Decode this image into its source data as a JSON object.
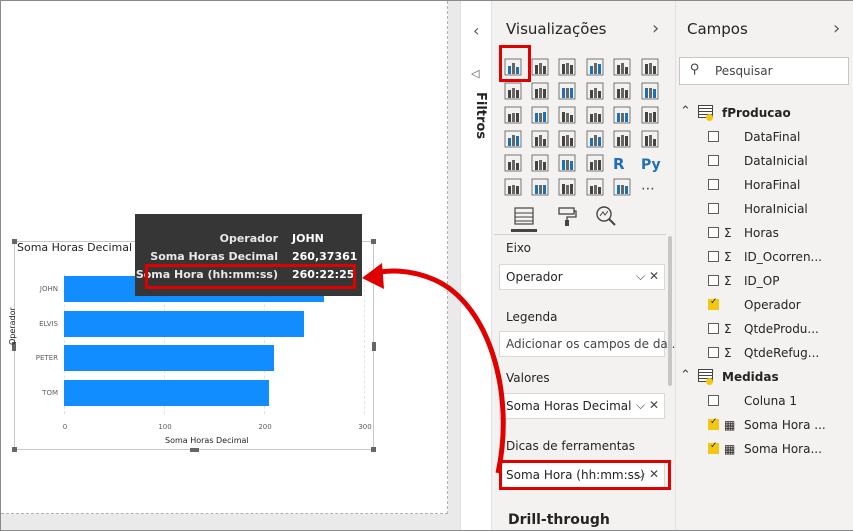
{
  "chart": {
    "title": "Soma Horas Decimal e",
    "xaxis_title": "Soma Horas Decimal",
    "yaxis_title": "Operador",
    "bar_color": "#118dff"
  },
  "chart_data": {
    "type": "bar",
    "orientation": "horizontal",
    "title": "Soma Horas Decimal e",
    "xlabel": "Soma Horas Decimal",
    "ylabel": "Operador",
    "categories": [
      "JOHN",
      "ELVIS",
      "PETER",
      "TOM"
    ],
    "values": [
      260.37361,
      240,
      210,
      205
    ],
    "x_ticks": [
      "0",
      "100",
      "200",
      "300"
    ],
    "xlim": [
      0,
      300
    ]
  },
  "tooltip": {
    "rows": [
      {
        "key": "Operador",
        "value": "JOHN"
      },
      {
        "key": "Soma Horas Decimal",
        "value": "260,37361"
      },
      {
        "key": "Soma Hora (hh:mm:ss)",
        "value": "260:22:25"
      }
    ]
  },
  "filters": {
    "label": "Filtros"
  },
  "visualizations": {
    "title": "Visualizações",
    "wells": [
      {
        "label": "Eixo",
        "value": "Operador",
        "has_controls": true
      },
      {
        "label": "Legenda",
        "value": "Adicionar os campos de da...",
        "has_controls": false
      },
      {
        "label": "Valores",
        "value": "Soma Horas Decimal",
        "has_controls": true
      },
      {
        "label": "Dicas de ferramentas",
        "value": "Soma Hora (hh:mm:ss)",
        "has_controls": true
      }
    ],
    "drill_through": "Drill-through",
    "icons_r": "R",
    "icons_py": "Py",
    "icons_more": "⋯"
  },
  "fields": {
    "title": "Campos",
    "search_placeholder": "Pesquisar",
    "tables": [
      {
        "name": "fProducao",
        "items": [
          {
            "name": "DataFinal",
            "checked": false,
            "sigma": false
          },
          {
            "name": "DataInicial",
            "checked": false,
            "sigma": false
          },
          {
            "name": "HoraFinal",
            "checked": false,
            "sigma": false
          },
          {
            "name": "HoraInicial",
            "checked": false,
            "sigma": false
          },
          {
            "name": "Horas",
            "checked": false,
            "sigma": true
          },
          {
            "name": "ID_Ocorren...",
            "checked": false,
            "sigma": true
          },
          {
            "name": "ID_OP",
            "checked": false,
            "sigma": true
          },
          {
            "name": "Operador",
            "checked": true,
            "sigma": false
          },
          {
            "name": "QtdeProdu...",
            "checked": false,
            "sigma": true
          },
          {
            "name": "QtdeRefug...",
            "checked": false,
            "sigma": true
          }
        ]
      },
      {
        "name": "Medidas",
        "items": [
          {
            "name": "Coluna 1",
            "checked": false,
            "sigma": false
          },
          {
            "name": "Soma Hora ...",
            "checked": true,
            "sigma": false,
            "calc": true
          },
          {
            "name": "Soma Hora...",
            "checked": true,
            "sigma": false,
            "calc": true
          }
        ]
      }
    ]
  },
  "colors": {
    "accent_red": "#e00000",
    "check_yellow": "#f2c811"
  }
}
